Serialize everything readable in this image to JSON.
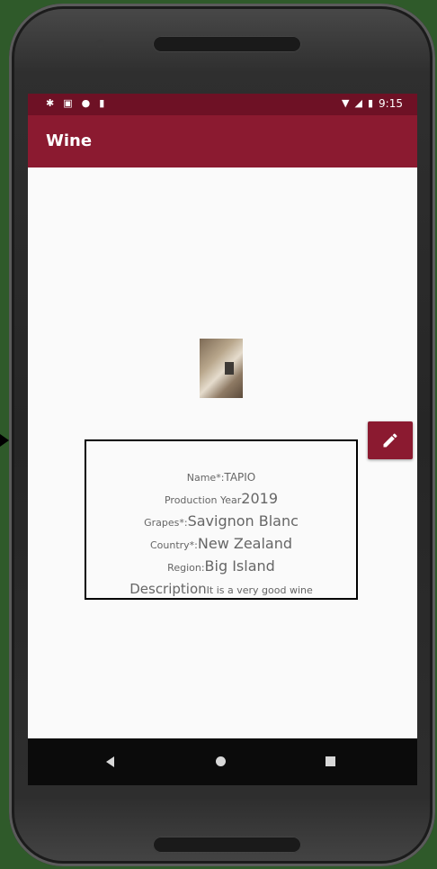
{
  "status_bar": {
    "time": "9:15",
    "left_icons": [
      "gear-icon",
      "photo-icon",
      "record-icon",
      "sd-card-icon"
    ],
    "right_icons": [
      "wifi-icon",
      "signal-icon",
      "battery-icon"
    ]
  },
  "app_bar": {
    "title": "Wine"
  },
  "wine": {
    "name_label": "Name*:",
    "name_value": "TAPIO",
    "year_label": "Production Year",
    "year_value": "2019",
    "grapes_label": "Grapes*:",
    "grapes_value": "Savignon Blanc",
    "country_label": "Country*:",
    "country_value": "New Zealand",
    "region_label": "Region:",
    "region_value": "Big Island",
    "description_label": "Description",
    "description_value": "It is a very good wine"
  },
  "colors": {
    "status_bar": "#6e1125",
    "app_bar": "#8b1a30",
    "fab": "#8b1a30",
    "nav_bar": "#0b0b0b"
  }
}
